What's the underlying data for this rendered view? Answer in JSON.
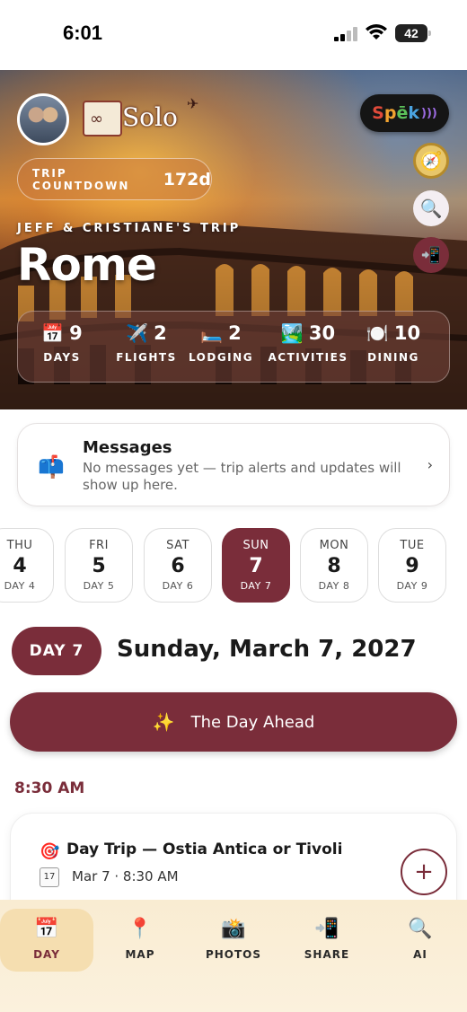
{
  "status_bar": {
    "time": "6:01",
    "battery": "42"
  },
  "hero": {
    "countdown_label": "TRIP COUNTDOWN",
    "countdown_value": "172d",
    "trip_owner": "JEFF & CRISTIANE'S TRIP",
    "city": "Rome",
    "logo_text": "Solo",
    "spek": {
      "s": "S",
      "p": "p",
      "e": "ē",
      "k": "k"
    },
    "stats": [
      {
        "icon": "calendar-icon",
        "glyph": "📅",
        "value": "9",
        "label": "DAYS"
      },
      {
        "icon": "airplane-icon",
        "glyph": "✈️",
        "value": "2",
        "label": "FLIGHTS"
      },
      {
        "icon": "bed-icon",
        "glyph": "🛏️",
        "value": "2",
        "label": "LODGING"
      },
      {
        "icon": "landscape-icon",
        "glyph": "🏞️",
        "value": "30",
        "label": "ACTIVITIES"
      },
      {
        "icon": "plate-icon",
        "glyph": "🍽️",
        "value": "10",
        "label": "DINING"
      }
    ]
  },
  "messages": {
    "title": "Messages",
    "body": "No messages yet — trip alerts and updates will show up here."
  },
  "dates": [
    {
      "dow": "THU",
      "num": "4",
      "label": "DAY 4",
      "active": false
    },
    {
      "dow": "FRI",
      "num": "5",
      "label": "DAY 5",
      "active": false
    },
    {
      "dow": "SAT",
      "num": "6",
      "label": "DAY 6",
      "active": false
    },
    {
      "dow": "SUN",
      "num": "7",
      "label": "DAY 7",
      "active": true
    },
    {
      "dow": "MON",
      "num": "8",
      "label": "DAY 8",
      "active": false
    },
    {
      "dow": "TUE",
      "num": "9",
      "label": "DAY 9",
      "active": false
    }
  ],
  "day_header": {
    "pill": "DAY 7",
    "title": "Sunday, March 7, 2027"
  },
  "day_ahead": {
    "label": "The Day Ahead"
  },
  "timeline": {
    "time": "8:30 AM",
    "event": {
      "title": "Day Trip — Ostia Antica or Tivoli",
      "meta": "Mar 7 · 8:30 AM",
      "cal_num": "17"
    }
  },
  "tabs": [
    {
      "id": "day",
      "label": "DAY",
      "icon": "calendar-icon",
      "active": true
    },
    {
      "id": "map",
      "label": "MAP",
      "icon": "map-pin-icon",
      "active": false
    },
    {
      "id": "photos",
      "label": "PHOTOS",
      "icon": "camera-icon",
      "active": false
    },
    {
      "id": "share",
      "label": "SHARE",
      "icon": "phone-share-icon",
      "active": false
    },
    {
      "id": "ai",
      "label": "AI",
      "icon": "search-icon",
      "active": false
    }
  ],
  "colors": {
    "accent": "#7a2d3a",
    "tab_bg": "#f9ecd2",
    "tab_active": "#f5deb0"
  }
}
